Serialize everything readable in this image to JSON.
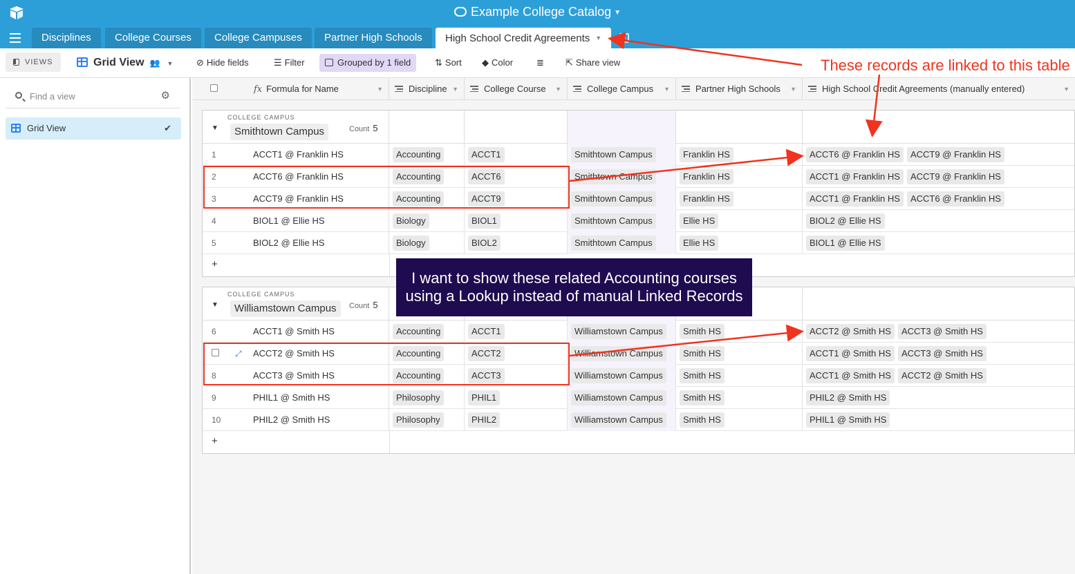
{
  "app": {
    "title": "Example College Catalog"
  },
  "tabs": [
    "Disciplines",
    "College Courses",
    "College Campuses",
    "Partner High Schools",
    "High School Credit Agreements"
  ],
  "toolbar": {
    "views_label": "VIEWS",
    "view_name": "Grid View",
    "hide_fields": "Hide fields",
    "filter": "Filter",
    "grouped": "Grouped by 1 field",
    "sort": "Sort",
    "color": "Color",
    "share": "Share view"
  },
  "sidebar": {
    "search_placeholder": "Find a view",
    "items": [
      {
        "label": "Grid View"
      }
    ]
  },
  "columns": {
    "name": "Formula for Name",
    "discipline": "Discipline",
    "course": "College Course",
    "campus": "College Campus",
    "partner": "Partner High Schools",
    "agreements": "High School Credit Agreements (manually entered)"
  },
  "groups": [
    {
      "label": "COLLEGE CAMPUS",
      "value": "Smithtown Campus",
      "count_label": "Count",
      "count": "5",
      "rows": [
        {
          "num": "1",
          "name": "ACCT1 @ Franklin HS",
          "discipline": "Accounting",
          "course": "ACCT1",
          "campus": "Smithtown Campus",
          "partner": "Franklin HS",
          "agreements": [
            "ACCT6 @ Franklin HS",
            "ACCT9 @ Franklin HS"
          ]
        },
        {
          "num": "2",
          "name": "ACCT6 @ Franklin HS",
          "discipline": "Accounting",
          "course": "ACCT6",
          "campus": "Smithtown Campus",
          "partner": "Franklin HS",
          "agreements": [
            "ACCT1 @ Franklin HS",
            "ACCT9 @ Franklin HS"
          ]
        },
        {
          "num": "3",
          "name": "ACCT9 @ Franklin HS",
          "discipline": "Accounting",
          "course": "ACCT9",
          "campus": "Smithtown Campus",
          "partner": "Franklin HS",
          "agreements": [
            "ACCT1 @ Franklin HS",
            "ACCT6 @ Franklin HS"
          ]
        },
        {
          "num": "4",
          "name": "BIOL1 @ Ellie HS",
          "discipline": "Biology",
          "course": "BIOL1",
          "campus": "Smithtown Campus",
          "partner": "Ellie HS",
          "agreements": [
            "BIOL2 @ Ellie HS"
          ]
        },
        {
          "num": "5",
          "name": "BIOL2 @ Ellie HS",
          "discipline": "Biology",
          "course": "BIOL2",
          "campus": "Smithtown Campus",
          "partner": "Ellie HS",
          "agreements": [
            "BIOL1 @ Ellie HS"
          ]
        }
      ]
    },
    {
      "label": "COLLEGE CAMPUS",
      "value": "Williamstown Campus",
      "count_label": "Count",
      "count": "5",
      "rows": [
        {
          "num": "6",
          "name": "ACCT1 @ Smith HS",
          "discipline": "Accounting",
          "course": "ACCT1",
          "campus": "Williamstown Campus",
          "partner": "Smith HS",
          "agreements": [
            "ACCT2 @ Smith HS",
            "ACCT3 @ Smith HS"
          ]
        },
        {
          "num": "",
          "name": "ACCT2 @ Smith HS",
          "discipline": "Accounting",
          "course": "ACCT2",
          "campus": "Williamstown Campus",
          "partner": "Smith HS",
          "agreements": [
            "ACCT1 @ Smith HS",
            "ACCT3 @ Smith HS"
          ]
        },
        {
          "num": "8",
          "name": "ACCT3 @ Smith HS",
          "discipline": "Accounting",
          "course": "ACCT3",
          "campus": "Williamstown Campus",
          "partner": "Smith HS",
          "agreements": [
            "ACCT1 @ Smith HS",
            "ACCT2 @ Smith HS"
          ]
        },
        {
          "num": "9",
          "name": "PHIL1 @ Smith HS",
          "discipline": "Philosophy",
          "course": "PHIL1",
          "campus": "Williamstown Campus",
          "partner": "Smith HS",
          "agreements": [
            "PHIL2 @ Smith HS"
          ]
        },
        {
          "num": "10",
          "name": "PHIL2 @ Smith HS",
          "discipline": "Philosophy",
          "course": "PHIL2",
          "campus": "Williamstown Campus",
          "partner": "Smith HS",
          "agreements": [
            "PHIL1 @ Smith HS"
          ]
        }
      ]
    }
  ],
  "add_row_symbol": "+",
  "annotations": {
    "linked_note": "These records are linked to this table",
    "lookup_note_line1": "I want to show these related Accounting courses",
    "lookup_note_line2": "using a Lookup instead of manual Linked Records",
    "color": "#f0331f"
  },
  "colors": {
    "brand": "#2d9fd8",
    "group_badge": "#e0d8f5",
    "note_bg": "#1f0b4f"
  }
}
